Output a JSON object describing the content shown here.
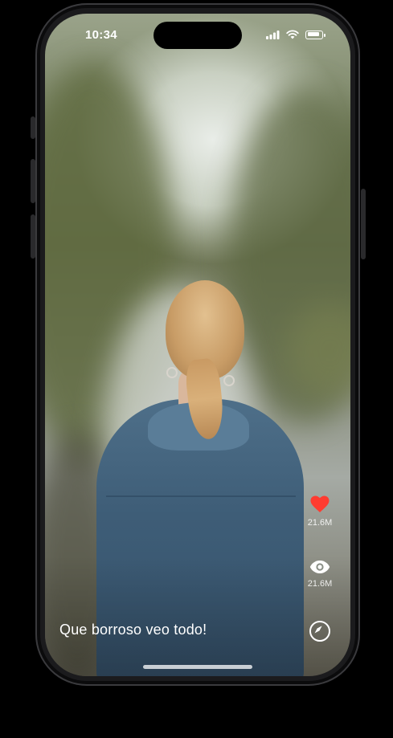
{
  "status_bar": {
    "time": "10:34",
    "icons": [
      "signal-icon",
      "wifi-icon",
      "battery-icon"
    ]
  },
  "post": {
    "caption": "Que borroso veo todo!",
    "likes": "21.6M",
    "views": "21.6M"
  },
  "icons": {
    "like": "heart-icon",
    "views": "eye-icon",
    "navigate": "compass-icon"
  },
  "colors": {
    "like": "#ff3b30",
    "text": "#ffffff"
  }
}
